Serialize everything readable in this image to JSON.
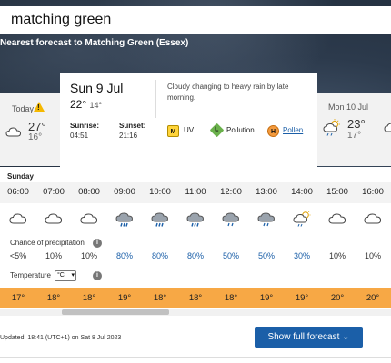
{
  "search": {
    "value": "matching green"
  },
  "location": {
    "nearest": "Nearest forecast to Matching Green (Essex)"
  },
  "days": {
    "today": {
      "label": "Today",
      "warning_icon": "warning-icon",
      "icon": "cloud-icon",
      "high": "27°",
      "low": "16°"
    },
    "selected": {
      "date": "Sun 9 Jul",
      "high": "22°",
      "low": "14°",
      "sunrise_label": "Sunrise:",
      "sunrise": "04:51",
      "sunset_label": "Sunset:",
      "sunset": "21:16",
      "description": "Cloudy changing to heavy rain by late morning.",
      "uv": {
        "badge": "M",
        "label": "UV"
      },
      "pollution": {
        "badge": "L",
        "label": "Pollution"
      },
      "pollen": {
        "badge": "H",
        "label": "Pollen"
      }
    },
    "next": {
      "label": "Mon 10 Jul",
      "icon": "sun-cloud-rain-icon",
      "high": "23°",
      "low": "17°"
    }
  },
  "hourly": {
    "day_label": "Sunday",
    "precip_label": "Chance of precipitation",
    "temp_label": "Temperature",
    "temp_unit": "°C",
    "hours": [
      {
        "time": "06:00",
        "icon": "cloud-icon",
        "precip": "<5%",
        "temp": "17°"
      },
      {
        "time": "07:00",
        "icon": "cloud-icon",
        "precip": "10%",
        "temp": "18°"
      },
      {
        "time": "08:00",
        "icon": "cloud-icon",
        "precip": "10%",
        "temp": "18°"
      },
      {
        "time": "09:00",
        "icon": "heavy-rain-icon",
        "precip": "80%",
        "temp": "19°"
      },
      {
        "time": "10:00",
        "icon": "heavy-rain-icon",
        "precip": "80%",
        "temp": "18°"
      },
      {
        "time": "11:00",
        "icon": "heavy-rain-icon",
        "precip": "80%",
        "temp": "18°"
      },
      {
        "time": "12:00",
        "icon": "light-rain-icon",
        "precip": "50%",
        "temp": "18°"
      },
      {
        "time": "13:00",
        "icon": "light-rain-icon",
        "precip": "50%",
        "temp": "19°"
      },
      {
        "time": "14:00",
        "icon": "sun-cloud-rain-icon",
        "precip": "30%",
        "temp": "19°"
      },
      {
        "time": "15:00",
        "icon": "cloud-icon",
        "precip": "10%",
        "temp": "20°"
      },
      {
        "time": "16:00",
        "icon": "cloud-icon",
        "precip": "10%",
        "temp": "20°"
      }
    ]
  },
  "footer": {
    "updated": "Updated: 18:41 (UTC+1) on Sat 8 Jul 2023",
    "full_forecast": "Show full forecast"
  },
  "colors": {
    "accent": "#1b5fa8",
    "temp_bar": "#f7a845",
    "rain_blue": "#1b5fa8"
  }
}
